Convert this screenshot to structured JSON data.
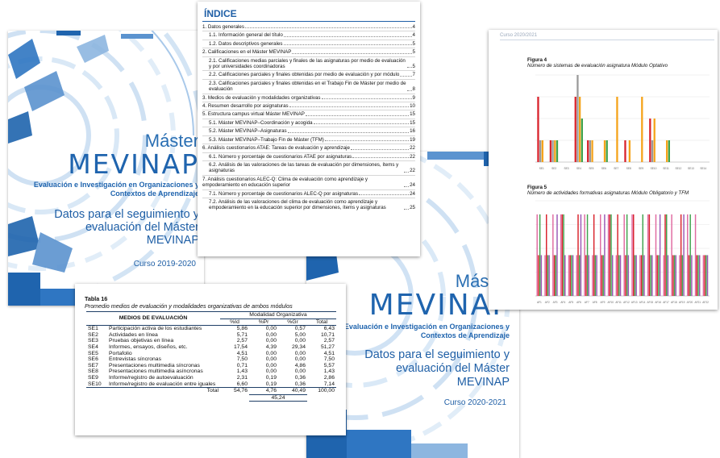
{
  "cover_left": {
    "master": "Máster",
    "brand": "MEVINAP",
    "subtitle_line1": "Evaluación e Investigación en Organizaciones y",
    "subtitle_line2": "Contextos de Aprendizaje",
    "title_line1": "Datos para el seguimiento y",
    "title_line2": "evaluación del Máster",
    "title_line3": "MEVINAP",
    "year": "Curso 2019-2020"
  },
  "cover_right": {
    "master": "Máster",
    "brand": "MEVINAP",
    "subtitle_line1": "Evaluación e Investigación en Organizaciones y",
    "subtitle_line2": "Contextos de Aprendizaje",
    "title_line1": "Datos para el seguimiento y",
    "title_line2": "evaluación del Máster",
    "title_line3": "MEVINAP",
    "year": "Curso 2020-2021"
  },
  "index": {
    "heading": "ÍNDICE",
    "entries": [
      {
        "text": "1. Datos generales",
        "page": "4",
        "indent": 0
      },
      {
        "text": "1.1. Información general del título",
        "page": "4",
        "indent": 1
      },
      {
        "text": "1.2. Datos descriptivos generales",
        "page": "5",
        "indent": 1
      },
      {
        "text": "2. Calificaciones en el Máster MEVINAP",
        "page": "5",
        "indent": 0
      },
      {
        "text": "2.1. Calificaciones medias parciales y finales de las asignaturas por medio de evaluación y por universidades coordinadoras",
        "page": "5",
        "indent": 1
      },
      {
        "text": "2.2. Calificaciones parciales y finales obtenidas por medio de evaluación y por módulo",
        "page": "7",
        "indent": 1
      },
      {
        "text": "2.3. Calificaciones parciales y finales obtenidas en el Trabajo Fin de Máster por medio de evaluación",
        "page": "8",
        "indent": 1
      },
      {
        "text": "3. Medios de evaluación y modalidades organizativas",
        "page": "9",
        "indent": 0
      },
      {
        "text": "4. Resumen desarrollo por asignaturas",
        "page": "10",
        "indent": 0
      },
      {
        "text": "5. Estructura campus virtual Máster MEVINAP",
        "page": "15",
        "indent": 0
      },
      {
        "text": "5.1. Máster MEVINAP–Coordinación y acogida",
        "page": "15",
        "indent": 1
      },
      {
        "text": "5.2. Máster MEVINAP–Asignaturas",
        "page": "16",
        "indent": 1
      },
      {
        "text": "5.3. Máster MEVINAP–Trabajo Fin de Máster (TFM)",
        "page": "19",
        "indent": 1
      },
      {
        "text": "6. Análisis cuestionarios ATAE: Tareas de evaluación y aprendizaje",
        "page": "22",
        "indent": 0
      },
      {
        "text": "6.1. Número y porcentaje de cuestionarios ATAE por asignaturas",
        "page": "22",
        "indent": 1
      },
      {
        "text": "6.2. Análisis de las valoraciones de las tareas de evaluación por dimensiones, ítems y asignaturas",
        "page": "22",
        "indent": 1
      },
      {
        "text": "7. Análisis cuestionarios ALEC-Q: Clima de evaluación como aprendizaje y empoderamiento en educación superior",
        "page": "24",
        "indent": 0
      },
      {
        "text": "7.1. Número y porcentaje de cuestionarios ALEC-Q por asignaturas",
        "page": "24",
        "indent": 1
      },
      {
        "text": "7.2. Análisis de las valoraciones del clima de evaluación como aprendizaje y empoderamiento en la educación superior por dimensiones, ítems y asignaturas",
        "page": "25",
        "indent": 1
      }
    ]
  },
  "table16": {
    "label": "Tabla 16",
    "caption": "Promedio medios de evaluación y modalidades organizativas de ambos módulos",
    "col_medios": "MEDIOS DE EVALUACIÓN",
    "col_group": "Modalidad Organizativa",
    "col_heads": [
      "%Id",
      "%Pr",
      "%Gr",
      "Total"
    ],
    "rows": [
      {
        "code": "SE1",
        "name": "Participación activa de los estudiantes",
        "v": [
          "5,86",
          "0,00",
          "0,57",
          "6,43"
        ]
      },
      {
        "code": "SE2",
        "name": "Actividades en línea",
        "v": [
          "5,71",
          "0,00",
          "5,00",
          "10,71"
        ]
      },
      {
        "code": "SE3",
        "name": "Pruebas objetivas en línea",
        "v": [
          "2,57",
          "0,00",
          "0,00",
          "2,57"
        ]
      },
      {
        "code": "SE4",
        "name": "Informes, ensayos, diseños, etc.",
        "v": [
          "17,54",
          "4,39",
          "29,34",
          "51,27"
        ]
      },
      {
        "code": "SE5",
        "name": "Portafolio",
        "v": [
          "4,51",
          "0,00",
          "0,00",
          "4,51"
        ]
      },
      {
        "code": "SE6",
        "name": "Entrevistas síncronas",
        "v": [
          "7,50",
          "0,00",
          "0,00",
          "7,50"
        ]
      },
      {
        "code": "SE7",
        "name": "Presentaciones multimedia síncronas",
        "v": [
          "0,71",
          "0,00",
          "4,86",
          "5,57"
        ]
      },
      {
        "code": "SE8",
        "name": "Presentaciones multimedia asíncronas",
        "v": [
          "1,43",
          "0,00",
          "0,00",
          "1,43"
        ]
      },
      {
        "code": "SE9",
        "name": "Informe/registro de autoevaluación",
        "v": [
          "2,31",
          "0,19",
          "0,36",
          "2,86"
        ]
      },
      {
        "code": "SE10",
        "name": "Informe/registro de evaluación entre iguales",
        "v": [
          "6,60",
          "0,19",
          "0,36",
          "7,14"
        ]
      }
    ],
    "total_label": "Total",
    "totals": [
      "54,76",
      "4,76",
      "40,49",
      "100,00"
    ],
    "subtotal": "45,24"
  },
  "figures_page": {
    "course": "Curso 2020/2021",
    "fig4_label": "Figura 4",
    "fig4_caption": "Número de sistemas de evaluación asignatura Módulo Optativo",
    "fig5_label": "Figura 5",
    "fig5_caption": "Número de actividades formativas asignaturas Módulo Obligatorio y TFM"
  },
  "chart_data": [
    {
      "type": "bar",
      "title": "Número de sistemas de evaluación asignatura Módulo Optativo",
      "categories": [
        "SE1",
        "SE2",
        "SE3",
        "SE4",
        "SE5",
        "SE6",
        "SE7",
        "SE8",
        "SE9",
        "SE10",
        "SE11",
        "SE12",
        "SE13",
        "SE14"
      ],
      "ylim": [
        0,
        4
      ],
      "series": [
        {
          "values": [
            3,
            1,
            0,
            3,
            1,
            0,
            0,
            1,
            0,
            2,
            0,
            0,
            0,
            0
          ]
        },
        {
          "values": [
            1,
            1,
            0,
            4,
            1,
            0,
            0,
            0,
            0,
            1,
            0,
            0,
            0,
            0
          ]
        },
        {
          "values": [
            1,
            1,
            0,
            3,
            1,
            1,
            3,
            1,
            3,
            2,
            1,
            0,
            0,
            0
          ]
        },
        {
          "values": [
            0,
            1,
            0,
            2,
            0,
            1,
            0,
            0,
            0,
            0,
            1,
            0,
            0,
            0
          ]
        }
      ]
    },
    {
      "type": "bar",
      "title": "Número de actividades formativas asignaturas Módulo Obligatorio y TFM",
      "categories": [
        "AF1",
        "AF2",
        "AF3",
        "AF4",
        "AF5",
        "AF6",
        "AF7",
        "AF8",
        "AF9",
        "AF10",
        "AF11",
        "AF12",
        "AF13",
        "AF14",
        "AF15",
        "AF16",
        "AF17",
        "AF18",
        "AF19",
        "AF20",
        "AF21",
        "AF22"
      ],
      "ylim": [
        0,
        7
      ],
      "series": [
        {
          "values": [
            6,
            3,
            6,
            6,
            3,
            3,
            6,
            3,
            6,
            6,
            3,
            6,
            6,
            3,
            6,
            6,
            3,
            6,
            3,
            6,
            6,
            3
          ]
        },
        {
          "values": [
            3,
            6,
            3,
            6,
            3,
            6,
            3,
            6,
            3,
            6,
            6,
            3,
            6,
            3,
            6,
            3,
            6,
            3,
            6,
            3,
            3,
            3
          ]
        },
        {
          "values": [
            6,
            3,
            3,
            6,
            3,
            3,
            6,
            3,
            3,
            6,
            3,
            6,
            3,
            6,
            3,
            3,
            6,
            3,
            3,
            6,
            3,
            3
          ]
        },
        {
          "values": [
            3,
            3,
            6,
            3,
            3,
            6,
            3,
            3,
            6,
            3,
            3,
            3,
            3,
            3,
            3,
            6,
            3,
            3,
            6,
            3,
            3,
            3
          ]
        }
      ]
    }
  ],
  "colors": {
    "brand_blue": "#1f64ae",
    "light_blue": "#cfe2f5",
    "bar_red": "#d9232c",
    "bar_orange": "#f5a31a",
    "bar_green": "#3fa34d",
    "bar_purple": "#9b59b6",
    "bar_pink": "#e06aa0",
    "bar_gray": "#9a9a9a"
  }
}
